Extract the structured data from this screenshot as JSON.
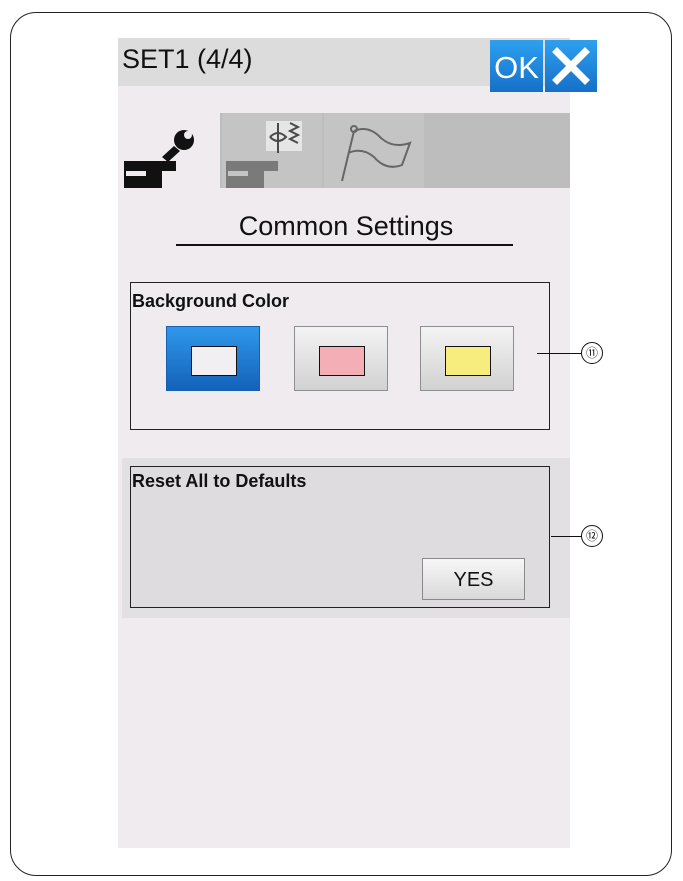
{
  "header": {
    "title": "SET1 (4/4)",
    "ok_label": "OK"
  },
  "tabs": [
    {
      "icon": "machine-wrench-icon",
      "selected": true
    },
    {
      "icon": "machine-stitch-icon",
      "selected": false
    },
    {
      "icon": "flag-icon",
      "selected": false
    },
    {
      "icon": null,
      "selected": false
    }
  ],
  "page": {
    "heading": "Common Settings"
  },
  "background_color": {
    "label": "Background Color",
    "options": [
      {
        "color": "#f2eff2",
        "selected": true
      },
      {
        "color": "#f4aeb5",
        "selected": false
      },
      {
        "color": "#f7ec7e",
        "selected": false
      }
    ]
  },
  "reset": {
    "label": "Reset All to Defaults",
    "yes_label": "YES"
  },
  "callouts": [
    "⑪",
    "⑫"
  ],
  "colors": {
    "accent_blue": "#1f7fd8",
    "screen_bg": "#efebee"
  }
}
